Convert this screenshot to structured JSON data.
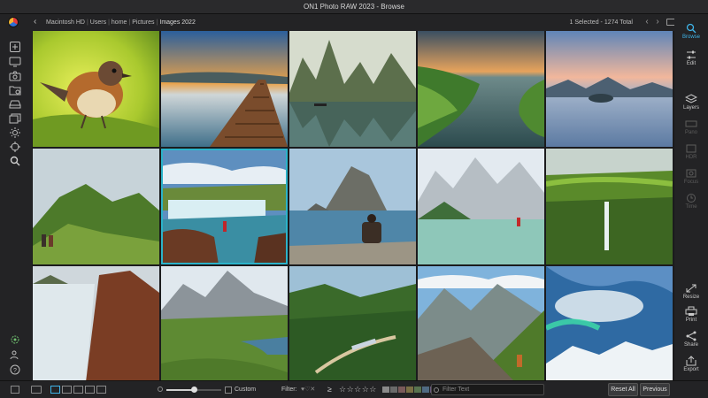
{
  "window": {
    "title": "ON1 Photo RAW 2023 - Browse"
  },
  "breadcrumb": {
    "items": [
      "Macintosh HD",
      "Users",
      "home",
      "Pictures"
    ],
    "current": "Images 2022",
    "separator": "|"
  },
  "selection": {
    "status": "1 Selected - 1274 Total"
  },
  "left_sidebar": {
    "icons": [
      "add-icon",
      "monitor-icon",
      "camera-icon",
      "folder-sync-icon",
      "drive-icon",
      "albums-icon",
      "brightness-icon",
      "target-icon",
      "search-icon",
      "settings-gear-icon",
      "people-icon",
      "help-icon"
    ]
  },
  "right_sidebar": {
    "items": [
      {
        "label": "Browse",
        "icon": "browse-icon",
        "state": "active"
      },
      {
        "label": "Edit",
        "icon": "sliders-icon",
        "state": "normal"
      },
      {
        "label": "Layers",
        "icon": "layers-icon",
        "state": "normal"
      },
      {
        "label": "Pano",
        "icon": "pano-icon",
        "state": "disabled"
      },
      {
        "label": "HDR",
        "icon": "hdr-icon",
        "state": "disabled"
      },
      {
        "label": "Focus",
        "icon": "focus-icon",
        "state": "disabled"
      },
      {
        "label": "Time",
        "icon": "time-icon",
        "state": "disabled"
      },
      {
        "label": "Resize",
        "icon": "resize-icon",
        "state": "normal"
      },
      {
        "label": "Print",
        "icon": "print-icon",
        "state": "normal"
      },
      {
        "label": "Share",
        "icon": "share-icon",
        "state": "normal"
      },
      {
        "label": "Export",
        "icon": "export-icon",
        "state": "normal"
      }
    ]
  },
  "grid": {
    "columns": 5,
    "rows": 3,
    "selected_index": 6,
    "photos": [
      "robin-bird",
      "wooden-pier-sunset",
      "karst-mountains-boat",
      "green-coast-sunset",
      "lake-islands-dusk",
      "hikers-green-hill",
      "waterfall-person-red",
      "person-sea-rock",
      "mountain-lake-person",
      "green-cliff-waterfall",
      "waterfall-cliff",
      "mountain-road-valley",
      "valley-train",
      "mountain-trail-hiker",
      "northern-lights-snow"
    ]
  },
  "bottom_bar": {
    "size_label": "Custom",
    "filter_label": "Filter:",
    "stars": "☆☆☆☆☆",
    "at_least_symbol": "≥",
    "color_labels": [
      "#8a8a8a",
      "#6a6a6a",
      "#7a5a5a",
      "#7a6f45",
      "#58734f",
      "#4f6a82",
      "#6a5a7e",
      "#5e5e5e"
    ],
    "search_placeholder": "Filter Text",
    "reset_button": "Reset All",
    "previous_button": "Previous",
    "thumb_size_fraction": 0.5
  },
  "colors": {
    "accent": "#2bb3c9",
    "background": "#1b1b1d",
    "panel": "#232325"
  }
}
